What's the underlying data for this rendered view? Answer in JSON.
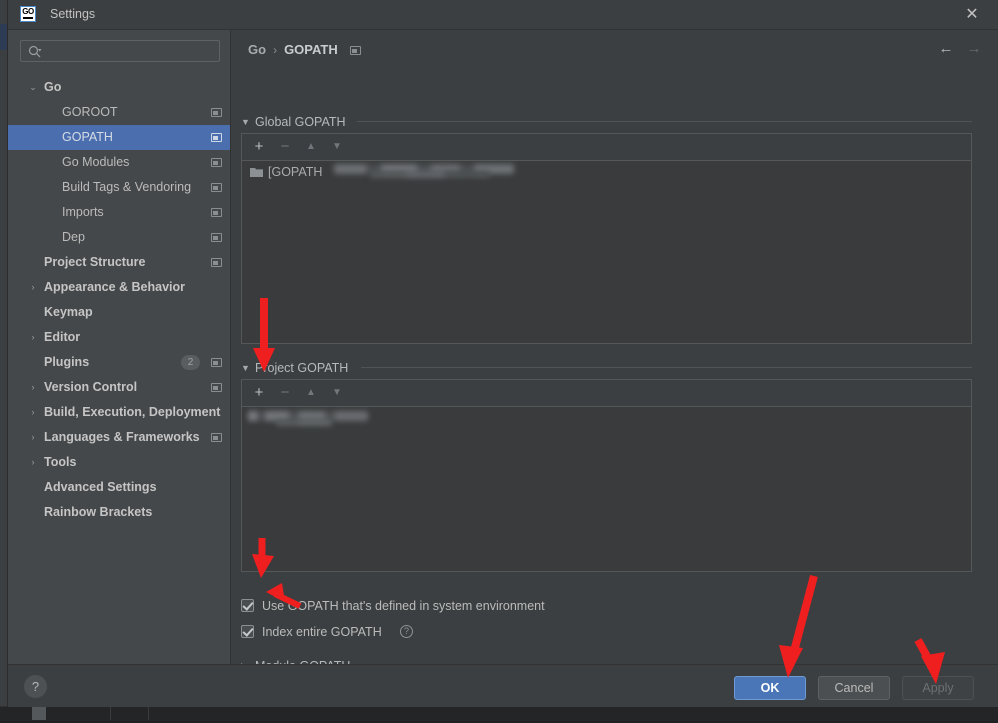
{
  "window": {
    "title": "Settings",
    "app_icon": "go-logo-icon",
    "close_label": "✕"
  },
  "sidebar": {
    "search": {
      "placeholder": "",
      "value": "",
      "icon": "search-icon"
    },
    "items": [
      {
        "label": "Go",
        "level": 0,
        "arrow": "⌄",
        "bold": true,
        "copy": false,
        "selected": false
      },
      {
        "label": "GOROOT",
        "level": 1,
        "arrow": "",
        "bold": false,
        "copy": true,
        "selected": false
      },
      {
        "label": "GOPATH",
        "level": 1,
        "arrow": "",
        "bold": false,
        "copy": true,
        "selected": true
      },
      {
        "label": "Go Modules",
        "level": 1,
        "arrow": "",
        "bold": false,
        "copy": true,
        "selected": false
      },
      {
        "label": "Build Tags & Vendoring",
        "level": 1,
        "arrow": "",
        "bold": false,
        "copy": true,
        "selected": false
      },
      {
        "label": "Imports",
        "level": 1,
        "arrow": "",
        "bold": false,
        "copy": true,
        "selected": false
      },
      {
        "label": "Dep",
        "level": 1,
        "arrow": "",
        "bold": false,
        "copy": true,
        "selected": false
      },
      {
        "label": "Project Structure",
        "level": 0,
        "arrow": "",
        "bold": true,
        "copy": true,
        "selected": false
      },
      {
        "label": "Appearance & Behavior",
        "level": 0,
        "arrow": "›",
        "bold": true,
        "copy": false,
        "selected": false
      },
      {
        "label": "Keymap",
        "level": 0,
        "arrow": "",
        "bold": true,
        "copy": false,
        "selected": false
      },
      {
        "label": "Editor",
        "level": 0,
        "arrow": "›",
        "bold": true,
        "copy": false,
        "selected": false
      },
      {
        "label": "Plugins",
        "level": 0,
        "arrow": "",
        "bold": true,
        "copy": true,
        "selected": false,
        "badge": "2"
      },
      {
        "label": "Version Control",
        "level": 0,
        "arrow": "›",
        "bold": true,
        "copy": true,
        "selected": false
      },
      {
        "label": "Build, Execution, Deployment",
        "level": 0,
        "arrow": "›",
        "bold": true,
        "copy": false,
        "selected": false
      },
      {
        "label": "Languages & Frameworks",
        "level": 0,
        "arrow": "›",
        "bold": true,
        "copy": true,
        "selected": false
      },
      {
        "label": "Tools",
        "level": 0,
        "arrow": "›",
        "bold": true,
        "copy": false,
        "selected": false
      },
      {
        "label": "Advanced Settings",
        "level": 0,
        "arrow": "",
        "bold": true,
        "copy": false,
        "selected": false
      },
      {
        "label": "Rainbow Brackets",
        "level": 0,
        "arrow": "",
        "bold": true,
        "copy": false,
        "selected": false
      }
    ]
  },
  "content": {
    "breadcrumb": {
      "root": "Go",
      "separator": "›",
      "current": "GOPATH",
      "copy_icon": "copy-settings-path-icon"
    },
    "nav": {
      "back": "←",
      "forward": "→"
    },
    "global_gopath": {
      "title": "Global GOPATH",
      "expanded": true,
      "triangle": "▼",
      "toolbar": {
        "add": "+",
        "remove": "−",
        "move_up": "▲",
        "move_down": "▼"
      },
      "items": [
        {
          "icon": "folder-icon",
          "text": "[GOPATH",
          "redacted": true
        }
      ]
    },
    "project_gopath": {
      "title": "Project GOPATH",
      "expanded": true,
      "triangle": "▼",
      "toolbar": {
        "add": "+",
        "remove": "−",
        "move_up": "▲",
        "move_down": "▼"
      },
      "items": [
        {
          "icon": "",
          "text": "",
          "redacted": true
        }
      ]
    },
    "options": [
      {
        "label": "Use GOPATH that's defined in system environment",
        "checked": true,
        "help": false
      },
      {
        "label": "Index entire GOPATH",
        "checked": true,
        "help": true,
        "help_glyph": "?"
      }
    ],
    "module_gopath": {
      "title": "Module GOPATH",
      "expanded": false,
      "triangle": "▶"
    }
  },
  "footer": {
    "help": "?",
    "buttons": [
      {
        "label": "OK",
        "style": "primary",
        "enabled": true
      },
      {
        "label": "Cancel",
        "style": "normal",
        "enabled": true
      },
      {
        "label": "Apply",
        "style": "disabled",
        "enabled": false
      }
    ]
  },
  "colors": {
    "dialog_bg": "#3c3f41",
    "sidebar_bg": "#45484a",
    "selection_blue": "#4b6eaf",
    "primary_button": "#4a76b8",
    "text": "#bbbbbb",
    "annotation_red": "#f01f1f"
  }
}
